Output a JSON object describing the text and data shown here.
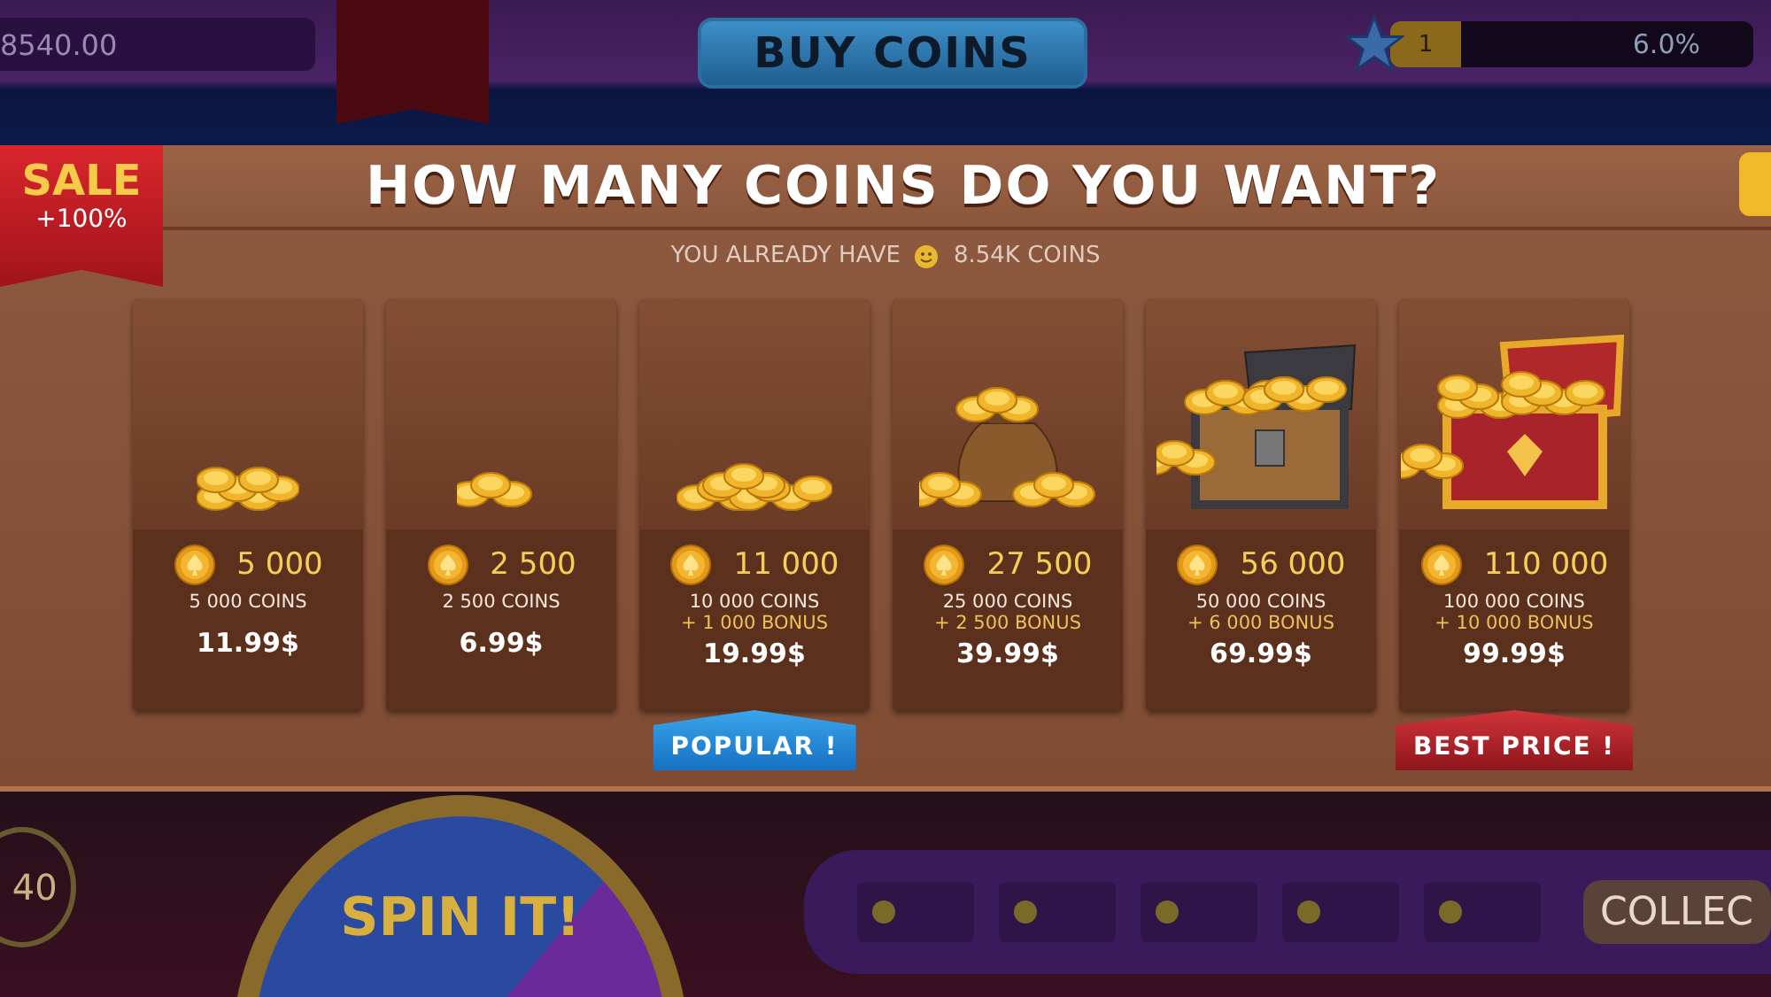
{
  "top_bar": {
    "balance": "8540.00",
    "buy_button": "BUY COINS",
    "player_level": "1",
    "xp_percent": "6.0%",
    "xp": {
      "level": 0.06
    }
  },
  "dialog": {
    "sale_ribbon": {
      "title": "SALE",
      "subtitle": "+100%"
    },
    "title": "HOW MANY COINS DO YOU WANT?",
    "owned_prefix": "YOU ALREADY HAVE",
    "owned_amount": "8.54K COINS",
    "packs": [
      {
        "kind": "small_pile",
        "amount": "5 000",
        "coins": "5 000 COINS",
        "price": "11.99$"
      },
      {
        "kind": "tiny_pile",
        "amount": "2 500",
        "coins": "2 500 COINS",
        "price": "6.99$"
      },
      {
        "kind": "pile",
        "amount": "11 000",
        "coins": "10 000 COINS",
        "bonus": "+ 1 000 BONUS",
        "price": "19.99$",
        "badge": {
          "kind": "popular",
          "label": "POPULAR !"
        }
      },
      {
        "kind": "bag",
        "amount": "27 500",
        "coins": "25 000 COINS",
        "bonus": "+ 2 500 BONUS",
        "price": "39.99$"
      },
      {
        "kind": "chest",
        "amount": "56 000",
        "coins": "50 000 COINS",
        "bonus": "+ 6 000 BONUS",
        "price": "69.99$"
      },
      {
        "kind": "big_chest",
        "amount": "110 000",
        "coins": "100 000 COINS",
        "bonus": "+ 10 000 BONUS",
        "price": "99.99$",
        "badge": {
          "kind": "best",
          "label": "BEST PRICE !"
        }
      }
    ]
  },
  "background": {
    "left_counter": "40",
    "wheel_label": "SPIN IT!",
    "collect_button": "COLLEC"
  }
}
